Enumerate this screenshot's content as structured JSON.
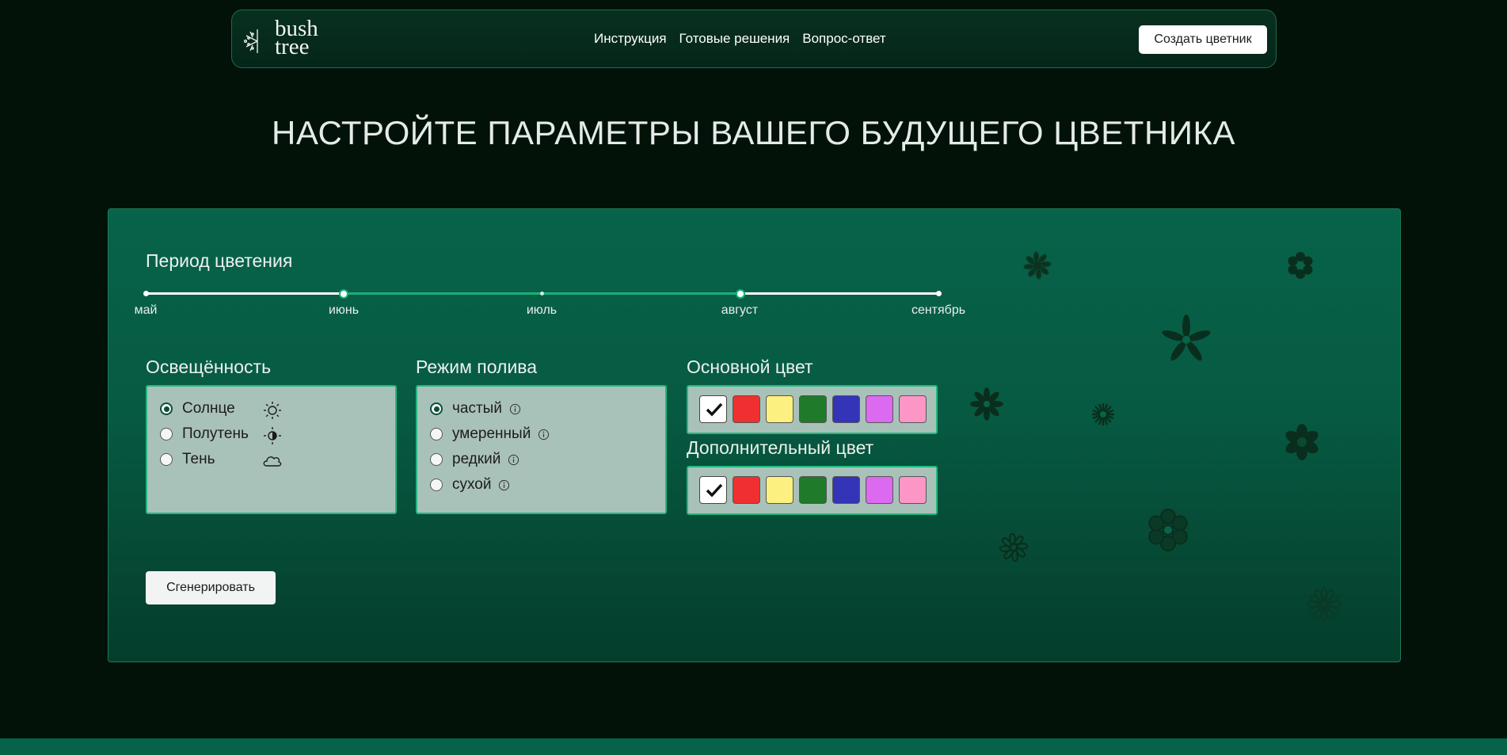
{
  "brand": {
    "logo_line1": "bush",
    "logo_line2": "tree"
  },
  "nav": {
    "items": [
      "Инструкция",
      "Готовые решения",
      "Вопрос-ответ"
    ],
    "cta": "Создать цветник"
  },
  "page_title": "НАСТРОЙТЕ ПАРАМЕТРЫ ВАШЕГО БУДУЩЕГО ЦВЕТНИКА",
  "bloom": {
    "title": "Период цветения",
    "months": [
      "май",
      "июнь",
      "июль",
      "август",
      "сентябрь"
    ],
    "selected_from": "июнь",
    "selected_to": "август"
  },
  "lighting": {
    "title": "Освещённость",
    "options": [
      {
        "label": "Солнце",
        "icon": "sun-icon",
        "selected": true
      },
      {
        "label": "Полутень",
        "icon": "half-sun-icon",
        "selected": false
      },
      {
        "label": "Тень",
        "icon": "cloud-icon",
        "selected": false
      }
    ]
  },
  "watering": {
    "title": "Режим полива",
    "options": [
      {
        "label": "частый",
        "selected": true
      },
      {
        "label": "умеренный",
        "selected": false
      },
      {
        "label": "редкий",
        "selected": false
      },
      {
        "label": "сухой",
        "selected": false
      }
    ]
  },
  "main_color": {
    "title": "Основной цвет",
    "swatches": [
      "#ffffff",
      "#f03030",
      "#fbf080",
      "#1f7a2a",
      "#3434b8",
      "#dc6af0",
      "#fc96c6"
    ],
    "selected_index": 0
  },
  "extra_color": {
    "title": "Дополнительный цвет",
    "swatches": [
      "#ffffff",
      "#f03030",
      "#fbf080",
      "#1f7a2a",
      "#3434b8",
      "#dc6af0",
      "#fc96c6"
    ],
    "selected_index": 0
  },
  "generate_button": "Сгенерировать",
  "colors": {
    "accent": "#18b07a",
    "panel": "#07634a",
    "option_bg": "#a9c2b9",
    "background": "#021208"
  }
}
